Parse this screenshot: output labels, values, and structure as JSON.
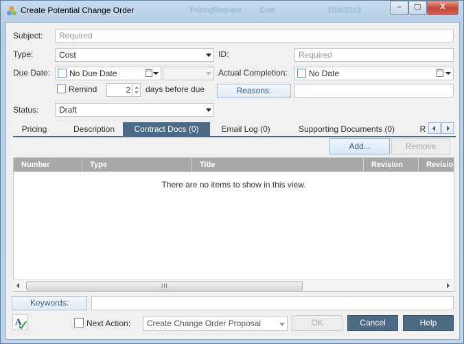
{
  "window": {
    "title": "Create Potential Change Order",
    "ghost_texts": [
      "PricingRequest",
      "Cost",
      "1/16/2013"
    ],
    "controls": {
      "minimize": "–",
      "maximize": "▢",
      "close": "X"
    }
  },
  "form": {
    "subject": {
      "label": "Subject:",
      "placeholder": "Required"
    },
    "type": {
      "label": "Type:",
      "value": "Cost"
    },
    "id": {
      "label": "ID:",
      "placeholder": "Required"
    },
    "due_date": {
      "label": "Due Date:",
      "value": "No Due Date"
    },
    "actual_completion": {
      "label": "Actual Completion:",
      "value": "No Date"
    },
    "remind": {
      "label": "Remind",
      "days": "2",
      "suffix": "days before due"
    },
    "reasons": {
      "label": "Reasons:"
    },
    "status": {
      "label": "Status:",
      "value": "Draft"
    }
  },
  "tabs": [
    {
      "label": "Pricing"
    },
    {
      "label": "Description"
    },
    {
      "label": "Contract Docs (0)"
    },
    {
      "label": "Email Log (0)"
    },
    {
      "label": "Supporting Documents (0)"
    },
    {
      "label": "R"
    }
  ],
  "actions": {
    "add": "Add...",
    "remove": "Remove"
  },
  "grid": {
    "columns": [
      "Number",
      "Type",
      "Title",
      "Revision",
      "Revision"
    ],
    "empty_message": "There are no items to show in this view.",
    "scroll_grip": "III"
  },
  "footer": {
    "keywords": "Keywords:",
    "next_action_label": "Next Action:",
    "next_action_value": "Create Change Order Proposal",
    "ok": "OK",
    "cancel": "Cancel",
    "help": "Help"
  },
  "colors": {
    "accent": "#4d6a85",
    "grid_header": "#a8a8a8"
  }
}
